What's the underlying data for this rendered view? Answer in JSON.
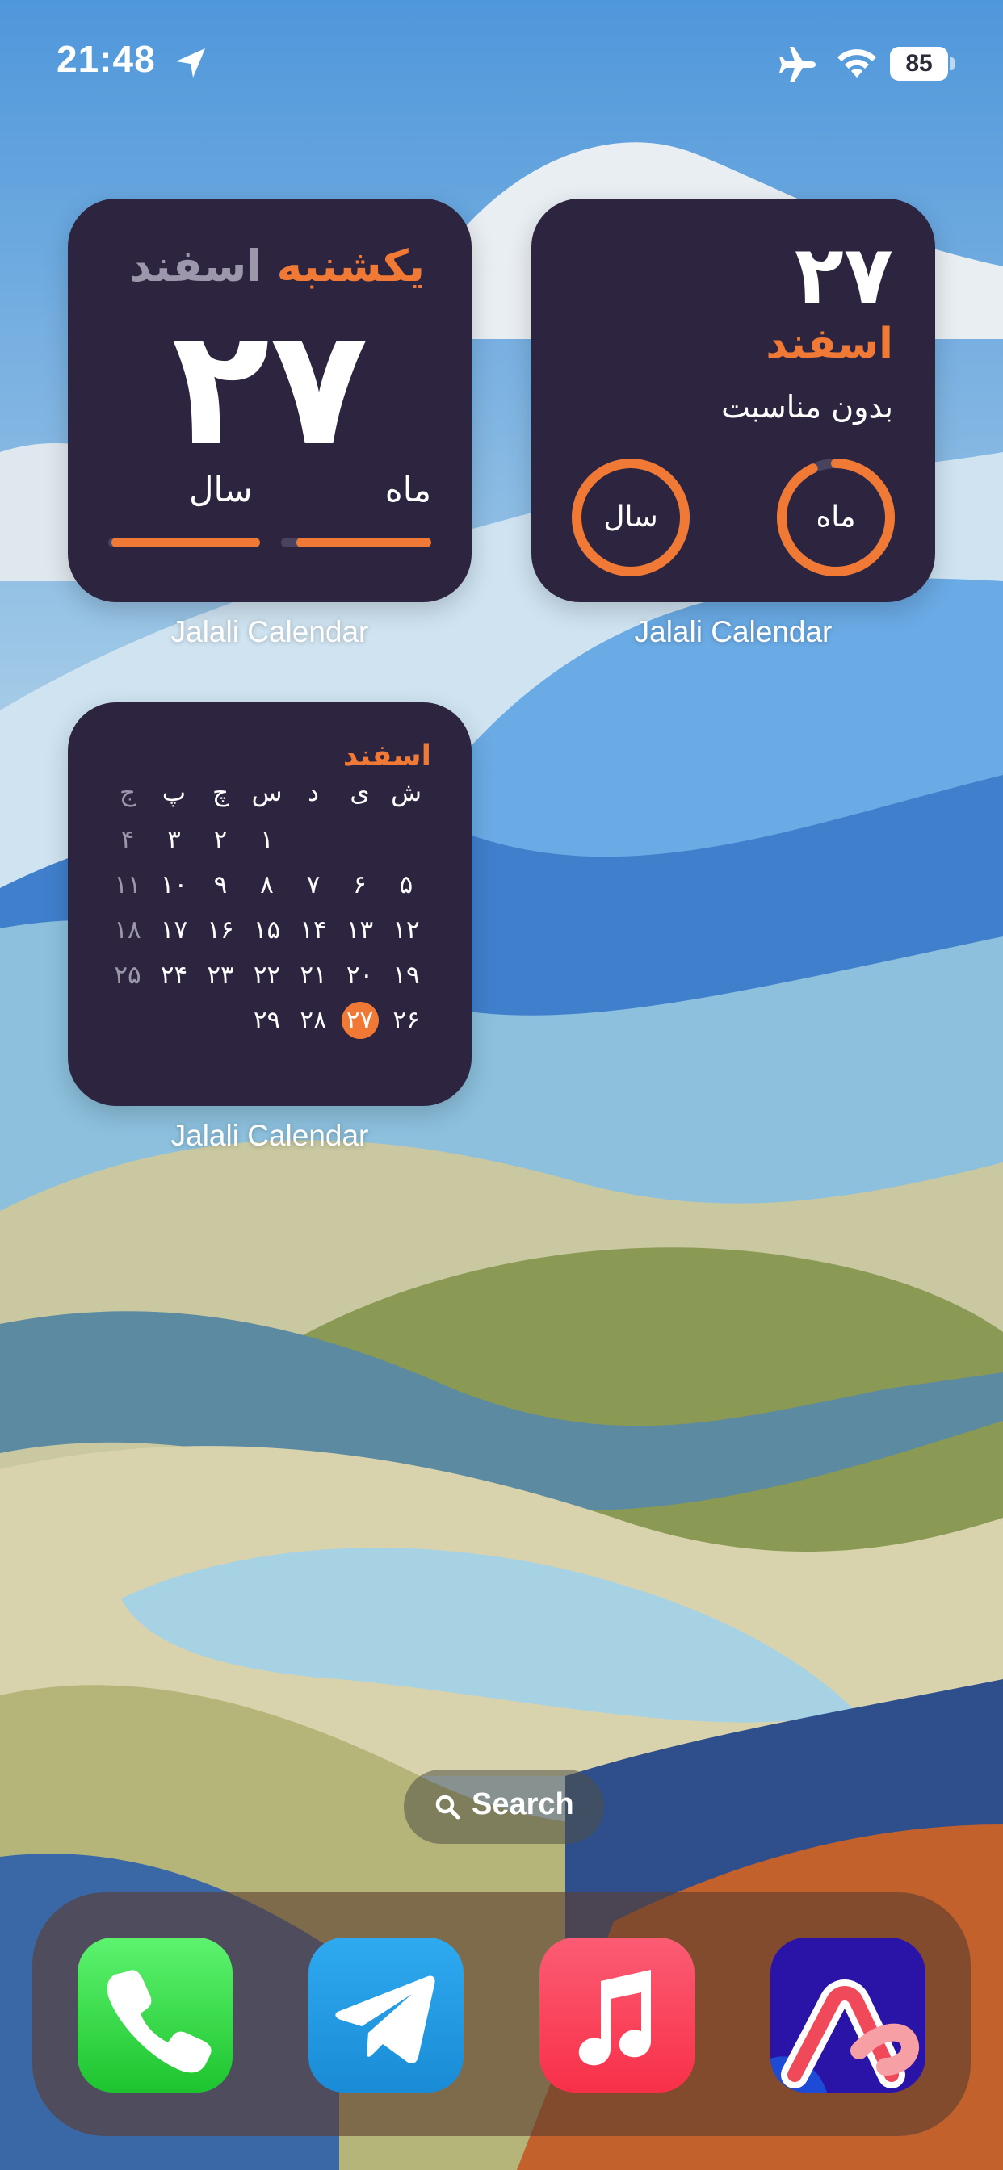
{
  "status_bar": {
    "time": "21:48",
    "battery": "85",
    "icons": [
      "location-arrow-icon",
      "airplane-icon",
      "wifi-icon",
      "battery-icon"
    ]
  },
  "widgets": {
    "date_widget": {
      "weekday": "یکشنبه",
      "month_name": "اسفند",
      "day_number": "۲۷",
      "month_label": "ماه",
      "year_label": "سال",
      "month_progress": 0.9,
      "year_progress": 0.98,
      "app_label": "Jalali Calendar"
    },
    "event_widget": {
      "day_number": "۲۷",
      "month_name": "اسفند",
      "event_text": "بدون مناسبت",
      "month_ring_label": "ماه",
      "year_ring_label": "سال",
      "month_progress": 0.93,
      "year_progress": 0.99,
      "app_label": "Jalali Calendar"
    },
    "month_widget": {
      "month_name": "اسفند",
      "weekday_headers": [
        "ش",
        "ی",
        "د",
        "س",
        "چ",
        "پ",
        "ج"
      ],
      "weeks": [
        [
          "",
          "",
          "",
          "۱",
          "۲",
          "۳",
          "۴"
        ],
        [
          "۵",
          "۶",
          "۷",
          "۸",
          "۹",
          "۱۰",
          "۱۱"
        ],
        [
          "۱۲",
          "۱۳",
          "۱۴",
          "۱۵",
          "۱۶",
          "۱۷",
          "۱۸"
        ],
        [
          "۱۹",
          "۲۰",
          "۲۱",
          "۲۲",
          "۲۳",
          "۲۴",
          "۲۵"
        ],
        [
          "۲۶",
          "۲۷",
          "۲۸",
          "۲۹",
          "",
          "",
          ""
        ]
      ],
      "today": "۲۷",
      "app_label": "Jalali Calendar"
    }
  },
  "search": {
    "label": "Search",
    "icon": "search-icon"
  },
  "dock": {
    "apps": [
      {
        "name": "Phone",
        "icon": "phone-icon"
      },
      {
        "name": "Telegram",
        "icon": "telegram-icon"
      },
      {
        "name": "Music",
        "icon": "music-icon"
      },
      {
        "name": "Arc",
        "icon": "arc-icon"
      }
    ]
  },
  "colors": {
    "widget_bg": "#2d2540",
    "accent_orange": "#f07a35",
    "muted_text": "#9c97aa"
  }
}
